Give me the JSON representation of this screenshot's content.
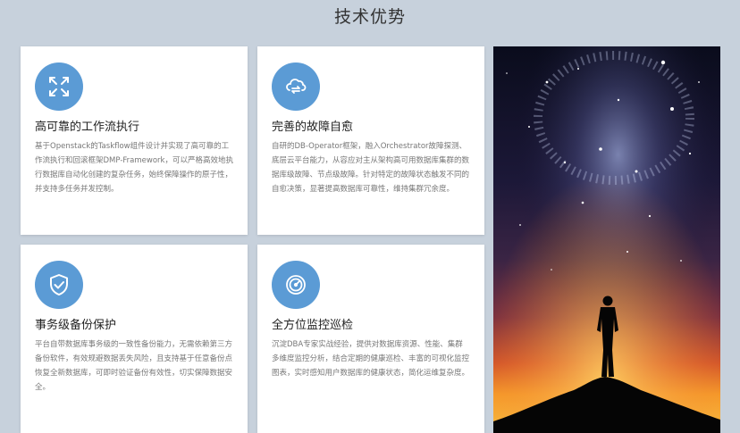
{
  "section": {
    "title": "技术优势"
  },
  "cards": [
    {
      "title": "高可靠的工作流执行",
      "desc": "基于Openstack的Taskflow组件设计并实现了高可靠的工作流执行和回滚框架DMP-Framework，可以严格高效地执行数据库自动化创建的复杂任务，始终保障操作的原子性，并支持多任务并发控制。",
      "icon": "arrows-expand-icon"
    },
    {
      "title": "完善的故障自愈",
      "desc": "自研的DB-Operator框架，融入Orchestrator故障探测、底层云平台能力，从容应对主从架构高可用数据库集群的数据库级故障、节点级故障。针对特定的故障状态触发不同的自愈决策，显著提高数据库可靠性，维持集群冗余度。",
      "icon": "cloud-heal-icon"
    },
    {
      "title": "事务级备份保护",
      "desc": "平台自带数据库事务级的一致性备份能力，无需依赖第三方备份软件，有效规避数据丢失风险，且支持基于任意备份点恢复全新数据库，可即时验证备份有效性，切实保障数据安全。",
      "icon": "shield-check-icon"
    },
    {
      "title": "全方位监控巡检",
      "desc": "沉淀DBA专家实战经验，提供对数据库资源、性能、集群多维度监控分析，结合定期的健康巡检、丰富的可视化监控图表，实时感知用户数据库的健康状态，简化运维复杂度。",
      "icon": "gauge-icon"
    }
  ],
  "colors": {
    "icon_bg": "#5b9bd5",
    "page_bg": "#c7d1dc"
  }
}
